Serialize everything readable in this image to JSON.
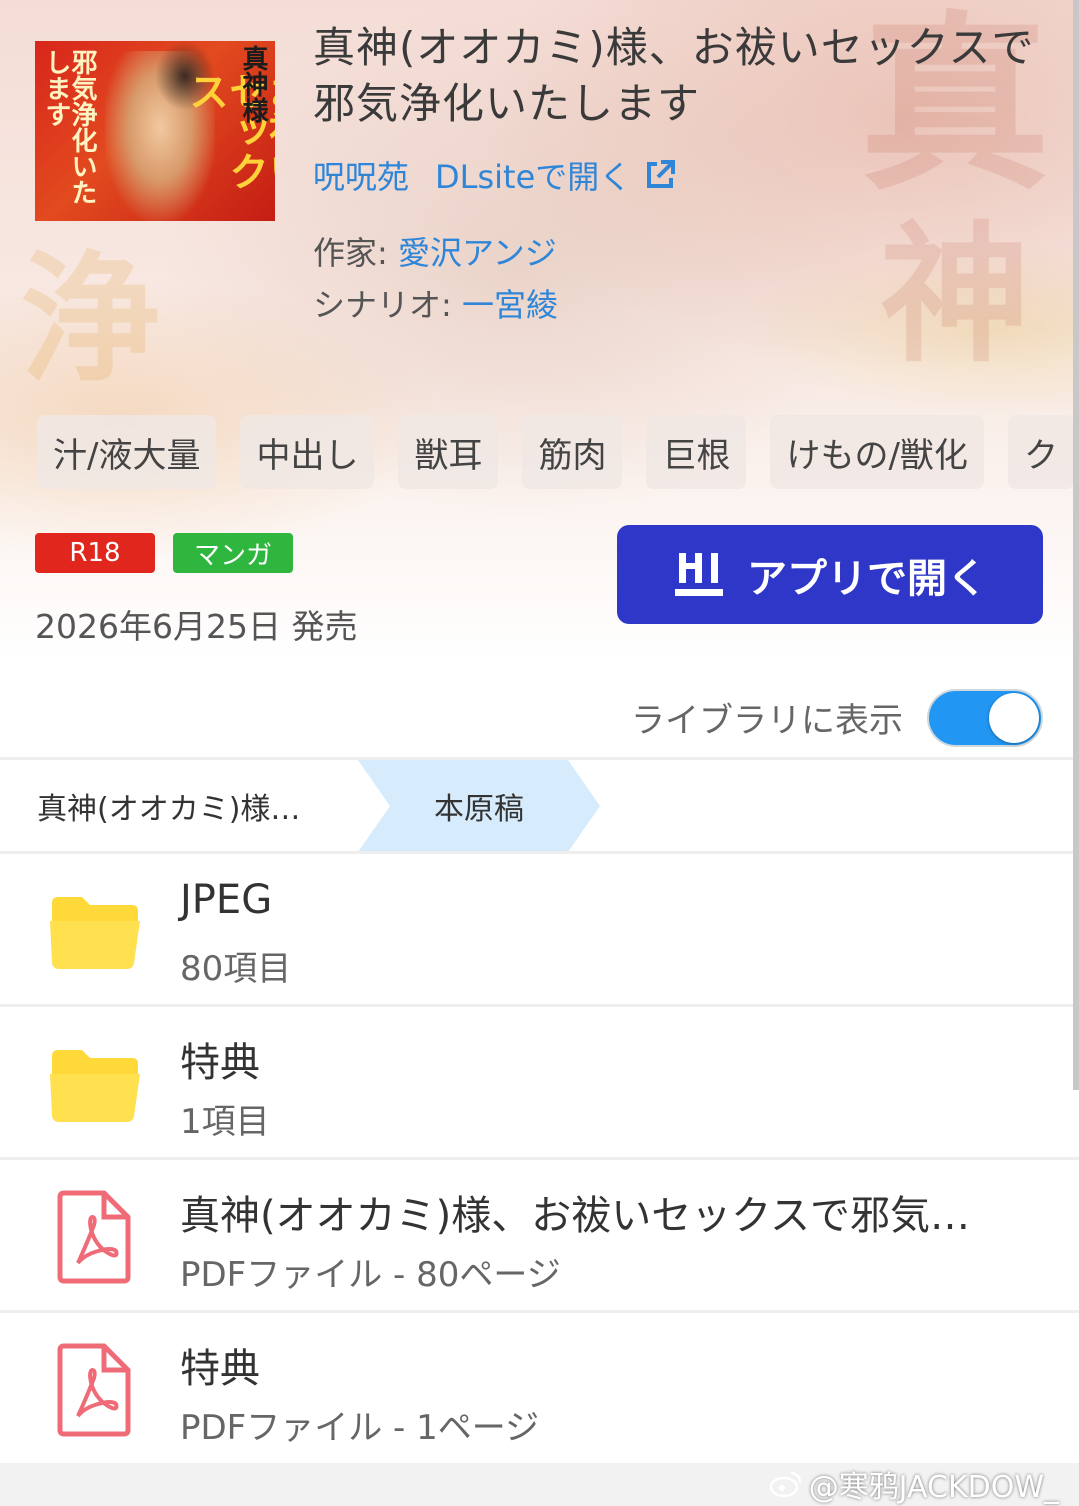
{
  "work": {
    "title": "真神(オオカミ)様、お祓いセックスで邪気浄化いたします",
    "circle": "呪呪苑",
    "dlsite_link": "DLsiteで開く",
    "author_label": "作家:",
    "author": "愛沢アンジ",
    "scenario_label": "シナリオ:",
    "scenario": "一宮綾",
    "release": "2026年6月25日 発売"
  },
  "cover": {
    "left_text": "邪気浄化いたします",
    "right_text": "お祓いセックス",
    "top_text": "真神様"
  },
  "tags": [
    "汁/液大量",
    "中出し",
    "獣耳",
    "筋肉",
    "巨根",
    "けもの/獣化",
    "ク"
  ],
  "badges": {
    "rating": "R18",
    "type": "マンガ"
  },
  "actions": {
    "open_app": "アプリで開く"
  },
  "library": {
    "label": "ライブラリに表示",
    "enabled": true
  },
  "breadcrumb": {
    "parent": "真神(オオカミ)様…",
    "current": "本原稿"
  },
  "files": [
    {
      "icon": "folder-icon",
      "name": "JPEG",
      "sub": "80項目"
    },
    {
      "icon": "folder-icon",
      "name": "特典",
      "sub": "1項目"
    },
    {
      "icon": "pdf-icon",
      "name": "真神(オオカミ)様、お祓いセックスで邪気…",
      "sub": "PDFファイル - 80ページ"
    },
    {
      "icon": "pdf-icon",
      "name": "特典",
      "sub": "PDFファイル - 1ページ"
    }
  ],
  "watermark": "@寒鸦JACKDOW_",
  "colors": {
    "link": "#2f86d8",
    "app_button": "#2f37c9",
    "r18": "#e0261d",
    "manga": "#2fb63e",
    "toggle": "#2196f3",
    "folder": "#ffe04f",
    "pdf": "#ef6b78"
  }
}
